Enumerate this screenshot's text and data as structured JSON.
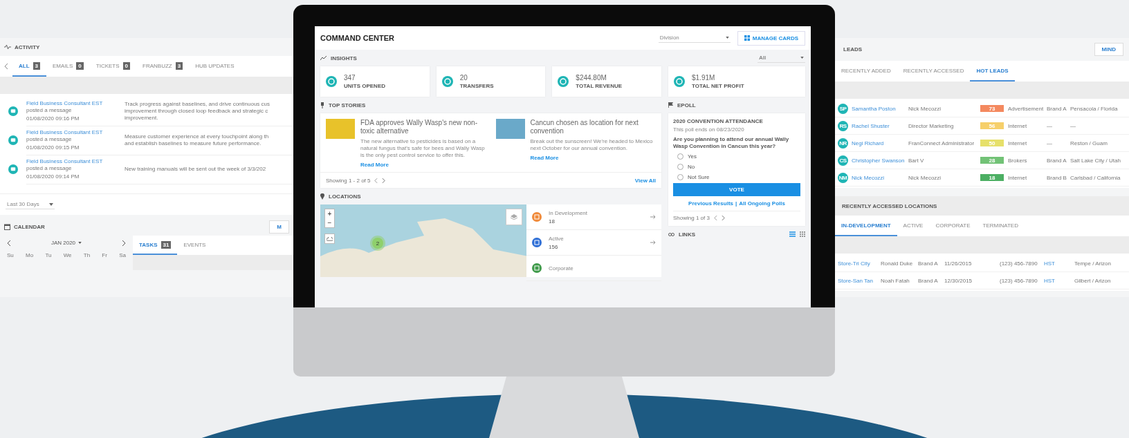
{
  "activity": {
    "title": "ACTIVITY",
    "tabs": [
      {
        "label": "ALL",
        "count": "3",
        "selected": true
      },
      {
        "label": "EMAILS",
        "count": "0",
        "selected": false
      },
      {
        "label": "TICKETS",
        "count": "0",
        "selected": false
      },
      {
        "label": "FRANBUZZ",
        "count": "3",
        "selected": false
      },
      {
        "label": "HUB UPDATES",
        "selected": false
      }
    ],
    "items": [
      {
        "author": "Field Business Consultant EST",
        "action": "posted a message",
        "time": "01/08/2020 09:16 PM",
        "message_lines": [
          "Track progress against baselines, and drive continuous cus",
          "improvement through closed loop feedback and strategic c",
          "improvement."
        ]
      },
      {
        "author": "Field Business Consultant EST",
        "action": "posted a message",
        "time": "01/08/2020 09:15 PM",
        "message_lines": [
          "Measure customer experience at every touchpoint along th",
          "and establish baselines to measure future performance."
        ]
      },
      {
        "author": "Field Business Consultant EST",
        "action": "posted a message",
        "time": "01/08/2020 09:14 PM",
        "message_lines": [
          "New training manuals will be sent out the week of 3/3/202"
        ]
      }
    ],
    "range": "Last 30 Days"
  },
  "calendar": {
    "title": "CALENDAR",
    "button": "M",
    "month": "JAN 2020",
    "weekdays": [
      "Su",
      "Mo",
      "Tu",
      "We",
      "Th",
      "Fr",
      "Sa"
    ],
    "tabs": [
      {
        "label": "TASKS",
        "count": "31",
        "selected": true
      },
      {
        "label": "EVENTS",
        "selected": false
      }
    ]
  },
  "command_center": {
    "title": "COMMAND CENTER",
    "division": {
      "placeholder": "Division"
    },
    "manage_button": "MANAGE CARDS",
    "insights": {
      "title": "INSIGHTS",
      "filter": "All",
      "cards": [
        {
          "value": "347",
          "label": "UNITS OPENED"
        },
        {
          "value": "20",
          "label": "TRANSFERS"
        },
        {
          "value": "$244.80M",
          "label": "TOTAL REVENUE"
        },
        {
          "value": "$1.91M",
          "label": "TOTAL NET PROFIT"
        }
      ]
    },
    "top_stories": {
      "title": "TOP STORIES",
      "stories": [
        {
          "title": "FDA approves Wally Wasp's new non-toxic alternative",
          "body": "The new alternative to pesticides is based on a natural fungus that's safe for bees and Wally Wasp is the only pest control service to offer this.",
          "link": "Read More",
          "color": "#e8c22a"
        },
        {
          "title": "Cancun chosen as location for next convention",
          "body": "Break out the sunscreen! We're headed to Mexico next October for our annual convention.",
          "link": "Read More",
          "color": "#6aa9c9"
        }
      ],
      "showing": "Showing 1 - 2 of 5",
      "view_all": "View All"
    },
    "locations": {
      "title": "LOCATIONS",
      "zoom_in": "+",
      "zoom_out": "−",
      "cluster": "2",
      "items": [
        {
          "label": "In Development",
          "count": "18",
          "color": "#f08a3a"
        },
        {
          "label": "Active",
          "count": "156",
          "color": "#2f6fd6"
        },
        {
          "label": "Corporate",
          "color": "#3f9a4a"
        }
      ]
    },
    "epoll": {
      "title": "EPOLL",
      "poll_title": "2020 CONVENTION ATTENDANCE",
      "ends": "This poll ends on 08/23/2020",
      "question": "Are you planning to attend our annual Wally Wasp Convention in Cancun this year?",
      "options": [
        {
          "label": "Yes",
          "selected": false
        },
        {
          "label": "No",
          "selected": false
        },
        {
          "label": "Not Sure",
          "selected": false
        }
      ],
      "vote": "VOTE",
      "previous": "Previous Results",
      "separator": "|",
      "ongoing": "All Ongoing Polls",
      "showing": "Showing 1 of 3"
    },
    "links": {
      "title": "LINKS"
    }
  },
  "leads": {
    "title": "LEADS",
    "button": "MIND",
    "tabs": [
      {
        "label": "RECENTLY ADDED",
        "selected": false
      },
      {
        "label": "RECENTLY ACCESSED",
        "selected": false
      },
      {
        "label": "HOT LEADS",
        "selected": true
      }
    ],
    "rows": [
      {
        "initials": "SP",
        "name": "Samantha Poston",
        "owner": "Nick Mecozzi",
        "score": "73",
        "color": "#f4895f",
        "source": "Advertisement",
        "brand": "Brand A",
        "location": "Pensacola / Florida"
      },
      {
        "initials": "RS",
        "name": "Rachel Shuster",
        "owner": "Director Marketing",
        "score": "56",
        "color": "#f6cf6a",
        "source": "Internet",
        "brand": "—",
        "location": "—"
      },
      {
        "initials": "NR",
        "name": "Negi Richard",
        "owner": "FranConnect Administrator",
        "score": "50",
        "color": "#e6e06a",
        "source": "Internet",
        "brand": "—",
        "location": "Reston / Guam"
      },
      {
        "initials": "CS",
        "name": "Christopher Swanson",
        "owner": "Bart V",
        "score": "28",
        "color": "#72c276",
        "source": "Brokers",
        "brand": "Brand A",
        "location": "Salt Lake City / Utah"
      },
      {
        "initials": "NM",
        "name": "Nick Mecozzi",
        "owner": "Nick Mecozzi",
        "score": "18",
        "color": "#4caf63",
        "source": "Internet",
        "brand": "Brand B",
        "location": "Carlsbad / California"
      }
    ]
  },
  "recent_locations": {
    "title": "RECENTLY ACCESSED LOCATIONS",
    "tabs": [
      {
        "label": "IN-DEVELOPMENT",
        "selected": true
      },
      {
        "label": "ACTIVE",
        "selected": false
      },
      {
        "label": "CORPORATE",
        "selected": false
      },
      {
        "label": "TERMINATED",
        "selected": false
      }
    ],
    "rows": [
      {
        "name": "Store-Tri City",
        "contact": "Ronald Duke",
        "brand": "Brand A",
        "date": "11/26/2015",
        "phone": "(123) 456-7890",
        "zone": "HST",
        "city": "Tempe / Arizon"
      },
      {
        "name": "Store-San Tan",
        "contact": "Noah Fatah",
        "brand": "Brand A",
        "date": "12/30/2015",
        "phone": "(123) 456-7890",
        "zone": "HST",
        "city": "Gilbert / Arizon"
      }
    ]
  }
}
